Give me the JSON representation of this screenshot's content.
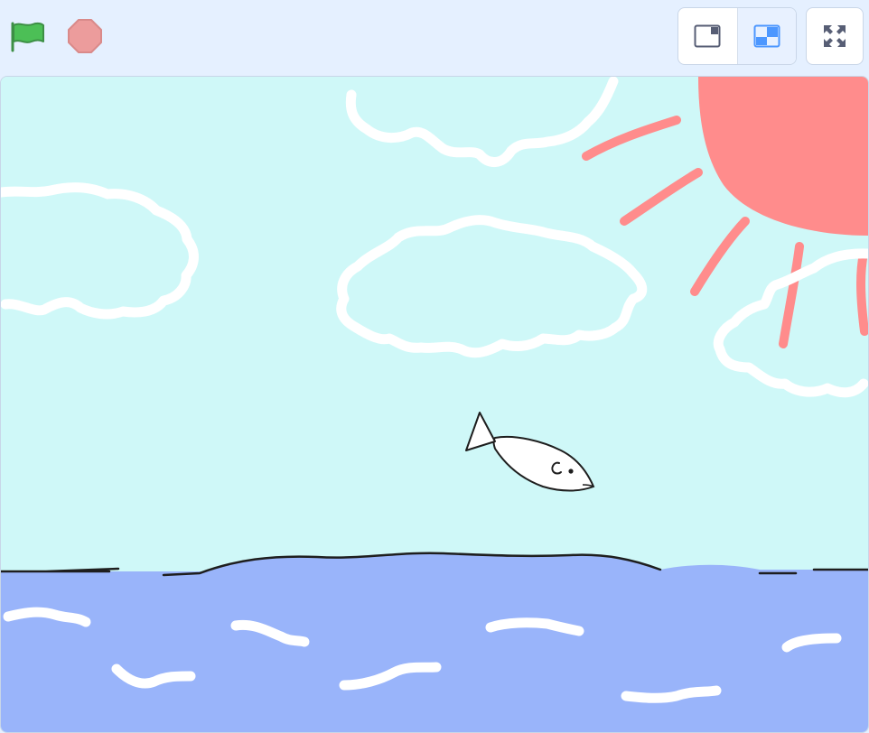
{
  "toolbar": {
    "green_flag_icon": "green-flag-icon",
    "stop_icon": "stop-sign-icon",
    "small_stage_icon": "small-stage-icon",
    "normal_stage_icon": "normal-stage-icon",
    "fullscreen_icon": "fullscreen-icon",
    "selected_mode": "normal"
  },
  "stage": {
    "backdrop": "sky-and-sea",
    "sprite": "fish"
  },
  "colors": {
    "flag_green": "#4cbf56",
    "stop_red": "#ec9c9c",
    "accent_blue": "#4c97ff",
    "sky": "#cff8f8",
    "sea": "#99b4fa",
    "sun": "#ff8c8c",
    "cloud": "#ffffff"
  }
}
